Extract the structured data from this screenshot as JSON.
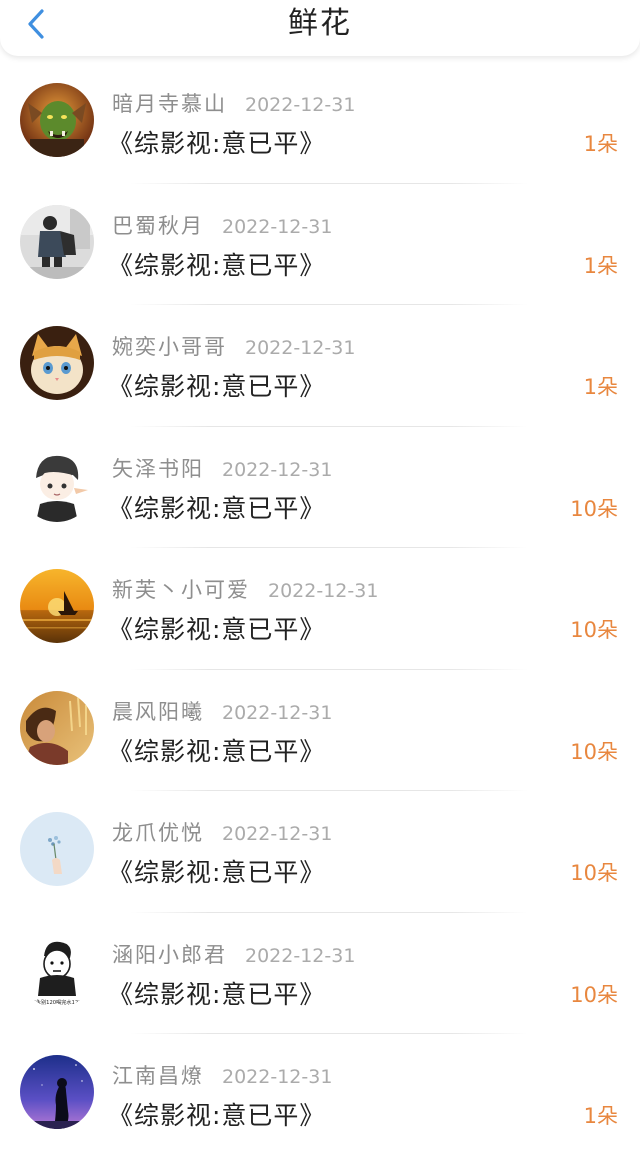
{
  "header": {
    "title": "鲜花",
    "back_icon": "chevron-left-icon",
    "accent_color": "#3f8fe0"
  },
  "flowers": [
    {
      "user": "暗月寺慕山",
      "date": "2022-12-31",
      "book": "《综影视:意已平》",
      "count": "1朵",
      "avatar": "orc-warrior-avatar"
    },
    {
      "user": "巴蜀秋月",
      "date": "2022-12-31",
      "book": "《综影视:意已平》",
      "count": "1朵",
      "avatar": "person-with-backpack-avatar"
    },
    {
      "user": "婉奕小哥哥",
      "date": "2022-12-31",
      "book": "《综影视:意已平》",
      "count": "1朵",
      "avatar": "cat-avatar"
    },
    {
      "user": "矢泽书阳",
      "date": "2022-12-31",
      "book": "《综影视:意已平》",
      "count": "10朵",
      "avatar": "anime-boy-avatar"
    },
    {
      "user": "新芙丶小可爱",
      "date": "2022-12-31",
      "book": "《综影视:意已平》",
      "count": "10朵",
      "avatar": "sunset-sailboat-avatar"
    },
    {
      "user": "晨风阳曦",
      "date": "2022-12-31",
      "book": "《综影视:意已平》",
      "count": "10朵",
      "avatar": "girl-in-wheat-field-avatar"
    },
    {
      "user": "龙爪优悦",
      "date": "2022-12-31",
      "book": "《综影视:意已平》",
      "count": "10朵",
      "avatar": "hand-holding-flower-avatar"
    },
    {
      "user": "涵阳小郎君",
      "date": "2022-12-31",
      "book": "《综影视:意已平》",
      "count": "10朵",
      "avatar": "cartoon-man-avatar",
      "avatar_caption": "\"永别120喝完水12\""
    },
    {
      "user": "江南昌燎",
      "date": "2022-12-31",
      "book": "《综影视:意已平》",
      "count": "1朵",
      "avatar": "night-sky-silhouette-avatar"
    }
  ],
  "colors": {
    "count_orange": "#e8873f",
    "name_gray": "#8e8e8e",
    "date_gray": "#ababab"
  }
}
